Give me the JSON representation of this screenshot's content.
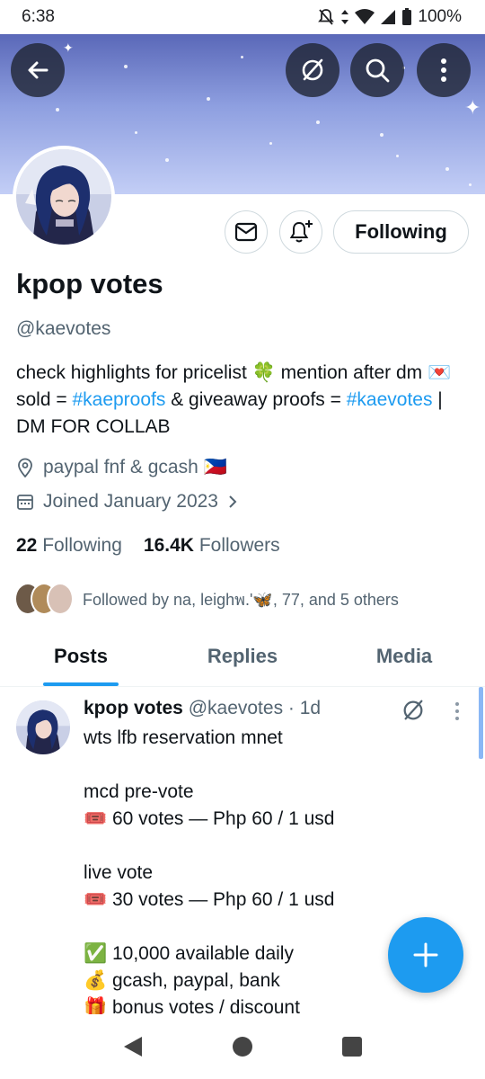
{
  "status_bar": {
    "time": "6:38",
    "battery": "100%"
  },
  "profile": {
    "name": "kpop votes",
    "handle": "@kaevotes",
    "follow_button": "Following",
    "bio": {
      "part1": "check highlights for pricelist 🍀 mention after dm 💌 sold = ",
      "tag1": "#kaeproofs",
      "part2": " & giveaway proofs = ",
      "tag2": "#kaevotes",
      "part3": " | DM FOR COLLAB"
    },
    "location": "paypal fnf & gcash 🇵🇭",
    "joined": "Joined January 2023",
    "following_count": "22",
    "following_label": "Following",
    "followers_count": "16.4K",
    "followers_label": "Followers",
    "followed_by": "Followed by na, leighพ.'🦋, 77, and 5 others"
  },
  "tabs": [
    {
      "label": "Posts",
      "active": true
    },
    {
      "label": "Replies",
      "active": false
    },
    {
      "label": "Media",
      "active": false
    }
  ],
  "post": {
    "author": "kpop votes",
    "handle_time": "@kaevotes · 1d",
    "body": "wts lfb reservation mnet\n\nmcd pre-vote\n🎟️ 60 votes — Php 60 / 1 usd\n\nlive vote\n🎟️ 30 votes — Php 60 / 1 usd\n\n✅ 10,000 available daily\n💰 gcash, paypal, bank\n🎁 bonus votes / discount"
  },
  "colors": {
    "accent": "#1d9bf0",
    "text": "#0f1419",
    "muted": "#536471",
    "banner_top": "#5a68b8",
    "banner_bottom": "#c3cef6"
  },
  "icons": [
    "back-arrow-icon",
    "grok-icon",
    "search-icon",
    "more-vertical-icon",
    "mail-icon",
    "bell-plus-icon",
    "location-pin-icon",
    "calendar-icon",
    "chevron-right-icon",
    "compose-plus-icon"
  ]
}
